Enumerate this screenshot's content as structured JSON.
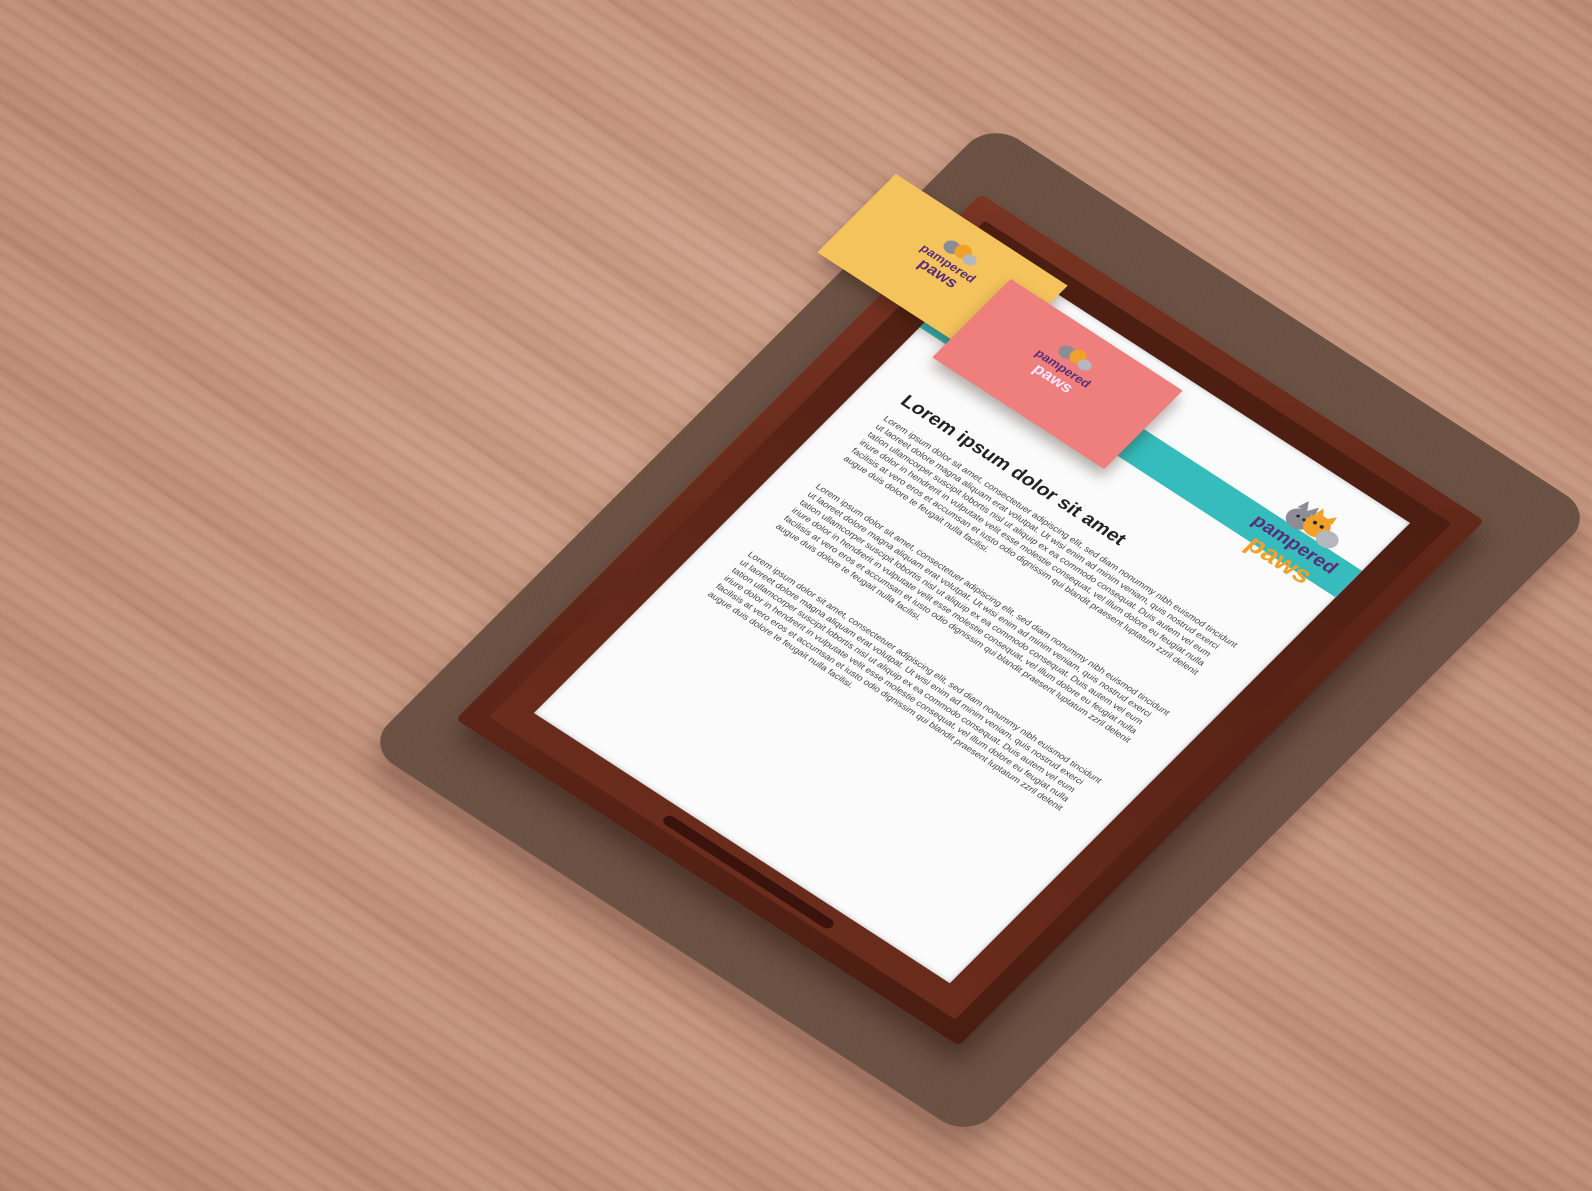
{
  "scene": {
    "colors": {
      "tabletop": "#c89a84",
      "mat": "#6e5445",
      "tray": "#5e2618",
      "paper": "#fbfbfb",
      "stripe": "#36bcbc",
      "card_yellow": "#f4c35c",
      "card_pink": "#ee7f7d"
    }
  },
  "letterhead": {
    "logo": {
      "word1": "pampered",
      "word2": "paws",
      "icon": "cat-dog-mascot-icon",
      "colors": {
        "word1": "#5a2d7a",
        "word2": "#f0a12a"
      }
    },
    "heading": "Lorem ipsum dolor sit amet",
    "paragraphs": [
      "Lorem ipsum dolor sit amet, consectetuer adipiscing elit, sed diam nonummy nibh euismod tincidunt ut laoreet dolore magna aliquam erat volutpat. Ut wisi enim ad minim veniam, quis nostrud exerci tation ullamcorper suscipit lobortis nisl ut aliquip ex ea commodo consequat. Duis autem vel eum iriure dolor in hendrerit in vulputate velit esse molestie consequat, vel illum dolore eu feugiat nulla facilisis at vero eros et accumsan et iusto odio dignissim qui blandit praesent luptatum zzril delenit augue duis dolore te feugait nulla facilisi.",
      "Lorem ipsum dolor sit amet, consectetuer adipiscing elit, sed diam nonummy nibh euismod tincidunt ut laoreet dolore magna aliquam erat volutpat. Ut wisi enim ad minim veniam, quis nostrud exerci tation ullamcorper suscipit lobortis nisl ut aliquip ex ea commodo consequat. Duis autem vel eum iriure dolor in hendrerit in vulputate velit esse molestie consequat, vel illum dolore eu feugiat nulla facilisis at vero eros et accumsan et iusto odio dignissim qui blandit praesent luptatum zzril delenit augue duis dolore te feugait nulla facilisi.",
      "Lorem ipsum dolor sit amet, consectetuer adipiscing elit, sed diam nonummy nibh euismod tincidunt ut laoreet dolore magna aliquam erat volutpat. Ut wisi enim ad minim veniam, quis nostrud exerci tation ullamcorper suscipit lobortis nisl ut aliquip ex ea commodo consequat. Duis autem vel eum iriure dolor in hendrerit in vulputate velit esse molestie consequat, vel illum dolore eu feugiat nulla facilisis at vero eros et accumsan et iusto odio dignissim qui blandit praesent luptatum zzril delenit augue duis dolore te feugait nulla facilisi."
    ]
  },
  "cards": [
    {
      "word1": "pampered",
      "word2": "paws",
      "color": "#f4c35c"
    },
    {
      "word1": "pampered",
      "word2": "paws",
      "color": "#ee7f7d"
    }
  ]
}
